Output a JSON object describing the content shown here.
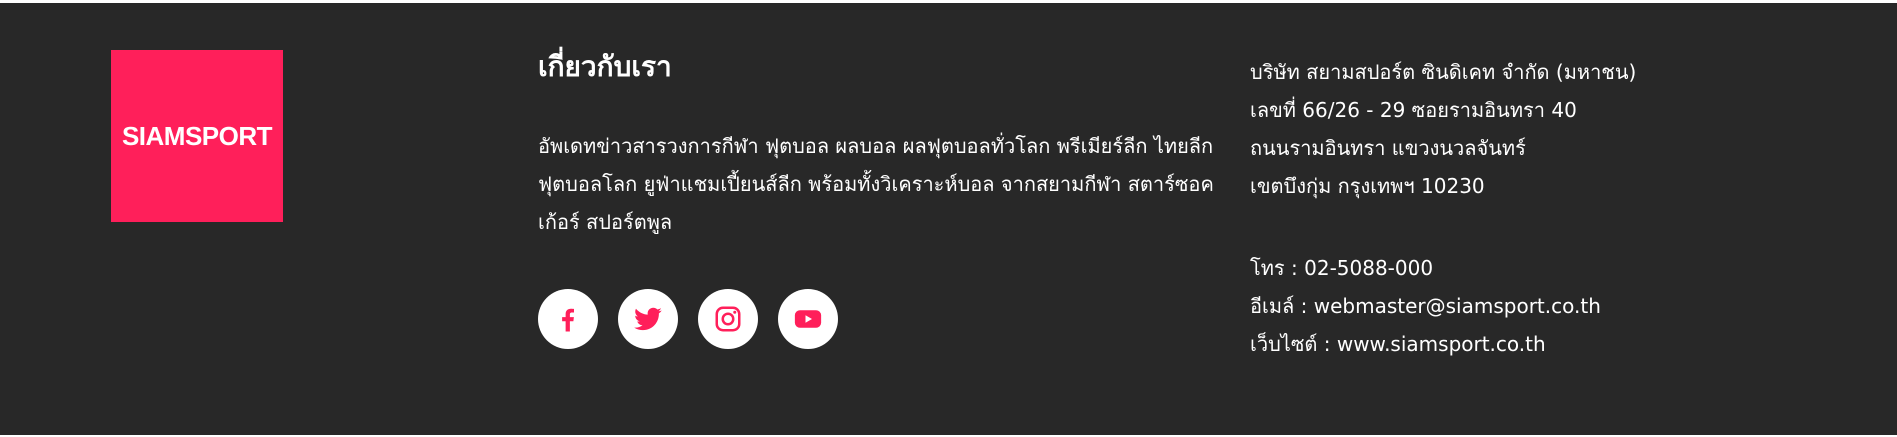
{
  "colors": {
    "background": "#282828",
    "brand": "#ff1f5a",
    "text": "#ffffff",
    "icon_bg": "#ffffff"
  },
  "logo": {
    "text": "SIAMSPORT"
  },
  "about": {
    "title": "เกี่ยวกับเรา",
    "text": "อัพเดทข่าวสารวงการกีฬา ฟุตบอล ผลบอล ผลฟุตบอลทั่วโลก พรีเมียร์ลีก ไทยลีก ฟุตบอลโลก ยูฟ่าแชมเปี้ยนส์ลีก พร้อมทั้งวิเคราะห์บอล จากสยามกีฬา สตาร์ซอคเก้อร์ สปอร์ตพูล"
  },
  "socials": [
    {
      "name": "facebook",
      "icon": "facebook-icon"
    },
    {
      "name": "twitter",
      "icon": "twitter-icon"
    },
    {
      "name": "instagram",
      "icon": "instagram-icon"
    },
    {
      "name": "youtube",
      "icon": "youtube-icon"
    }
  ],
  "contact": {
    "company": "บริษัท สยามสปอร์ต ซินดิเคท จำกัด (มหาชน)",
    "address_line1": "เลขที่ 66/26 - 29 ซอยรามอินทรา 40",
    "address_line2": "ถนนรามอินทรา แขวงนวลจันทร์",
    "address_line3": "เขตบึงกุ่ม กรุงเทพฯ 10230",
    "phone": "โทร : 02-5088-000",
    "email": "อีเมล์ : webmaster@siamsport.co.th",
    "website": "เว็บไซต์ : www.siamsport.co.th"
  }
}
